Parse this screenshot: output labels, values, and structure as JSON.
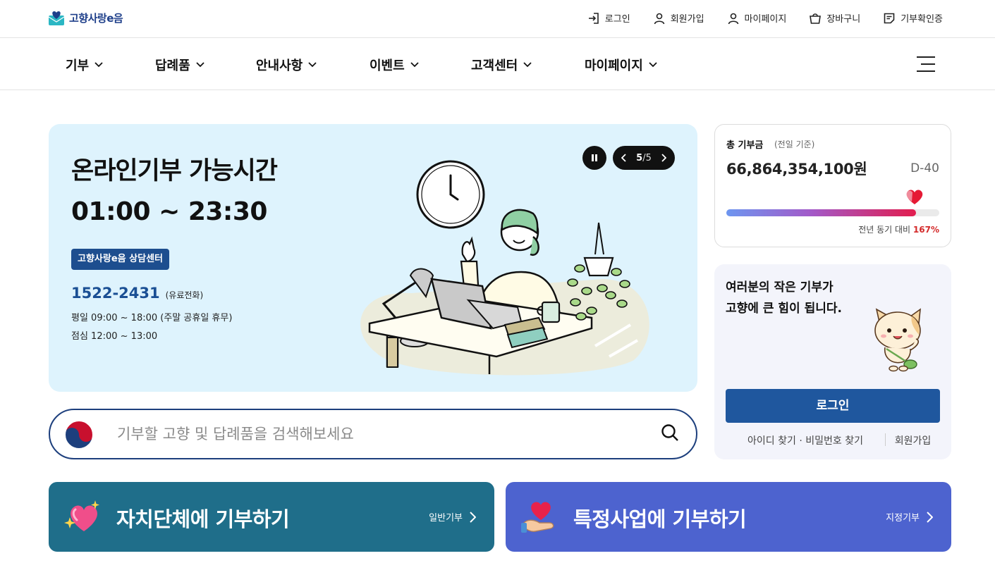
{
  "brand": {
    "name": "고향사랑e음"
  },
  "utility": [
    {
      "label": "로그인",
      "icon": "login-icon"
    },
    {
      "label": "회원가입",
      "icon": "user-icon"
    },
    {
      "label": "마이페이지",
      "icon": "user-icon"
    },
    {
      "label": "장바구니",
      "icon": "cart-icon"
    },
    {
      "label": "기부확인증",
      "icon": "receipt-icon"
    }
  ],
  "nav": [
    "기부",
    "답례품",
    "안내사항",
    "이벤트",
    "고객센터",
    "마이페이지"
  ],
  "hero": {
    "title": "온라인기부 가능시간",
    "time": "01:00 ~ 23:30",
    "badge": "고향사랑e음 상담센터",
    "phone": "1522-2431",
    "phone_note": "(유료전화)",
    "hours_weekday": "평일 09:00 ~ 18:00 (주말 공휴일 휴무)",
    "hours_lunch": "점심 12:00 ~ 13:00",
    "pager_current": "5",
    "pager_total": "/5"
  },
  "search": {
    "placeholder": "기부할 고향 및 답례품을 검색해보세요"
  },
  "total": {
    "label": "총 기부금",
    "sub": "(전일 기준)",
    "amount": "66,864,354,100원",
    "dday": "D-40",
    "compare_label": "전년 동기 대비",
    "compare_value": "167%",
    "progress": 0.89
  },
  "login": {
    "msg_line1": "여러분의 작은 기부가",
    "msg_line2": "고향에 큰 힘이 됩니다.",
    "button": "로그인",
    "find": "아이디 찾기 · 비밀번호 찾기",
    "join": "회원가입"
  },
  "banners": [
    {
      "title": "자치단체에 기부하기",
      "link": "일반기부"
    },
    {
      "title": "특정사업에 기부하기",
      "link": "지정기부"
    }
  ],
  "colors": {
    "brand_blue": "#1f579e",
    "hero_bg": "#def3fd",
    "banner1": "#1f6e8a",
    "banner2": "#4d63cf",
    "accent_red": "#d42a2a"
  }
}
